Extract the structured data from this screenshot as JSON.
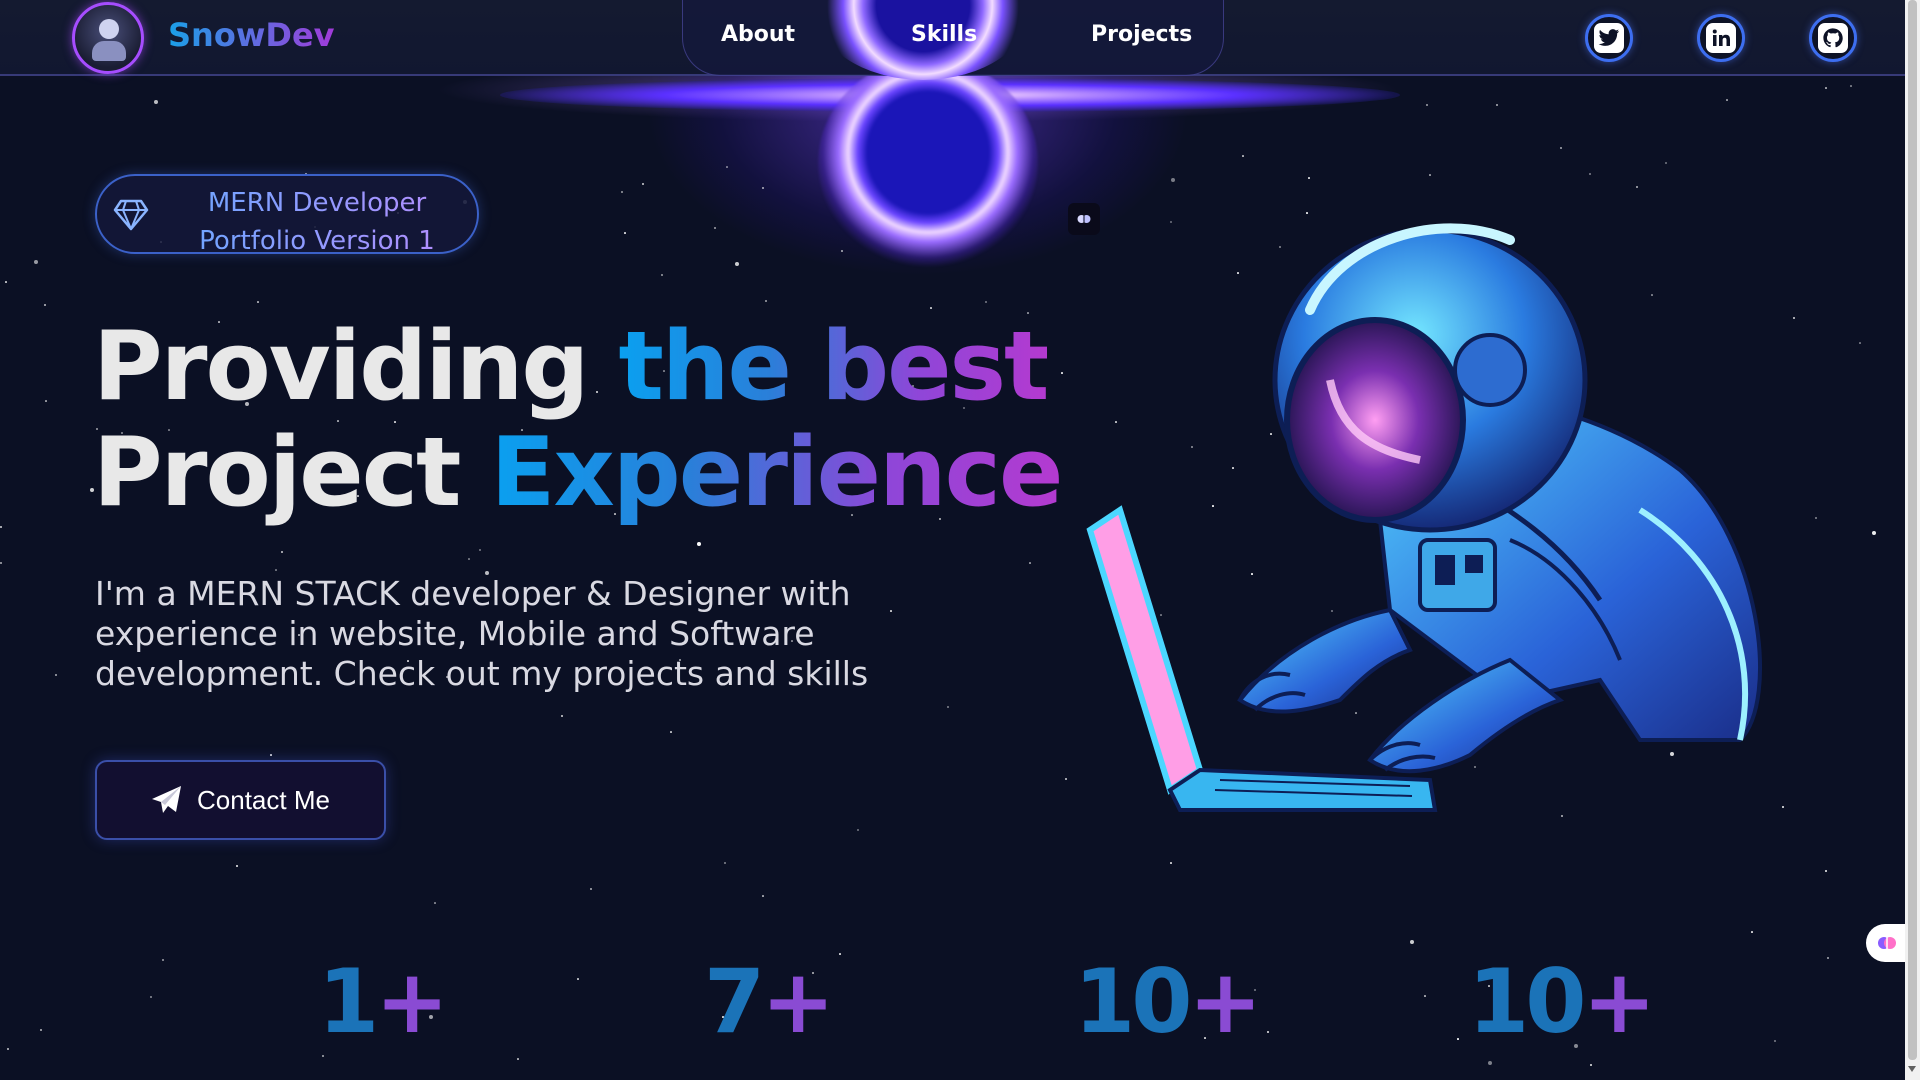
{
  "brand": {
    "name": "SnowDev"
  },
  "nav": {
    "items": [
      "About",
      "Skills",
      "Projects"
    ]
  },
  "social": [
    {
      "icon": "twitter-icon"
    },
    {
      "icon": "linkedin-icon"
    },
    {
      "icon": "github-icon"
    }
  ],
  "hero": {
    "badge_line1": "MERN Developer",
    "badge_line2": "Portfolio Version 1",
    "headline_plain1": "Providing ",
    "headline_grad1": "the best",
    "headline_plain2": "Project ",
    "headline_grad2": "Experience",
    "description": "I'm a MERN STACK developer & Designer with experience in website, Mobile and Software development. Check out my projects and skills",
    "contact_label": "Contact Me"
  },
  "stats": [
    {
      "num": "1",
      "suffix": "+"
    },
    {
      "num": "7",
      "suffix": "+"
    },
    {
      "num": "10",
      "suffix": "+"
    },
    {
      "num": "10",
      "suffix": "+"
    }
  ],
  "colors": {
    "background": "#0b1024",
    "accent_blue": "#0aa0f0",
    "accent_purple": "#b43ad0",
    "nav_border": "#3d6ef0"
  }
}
